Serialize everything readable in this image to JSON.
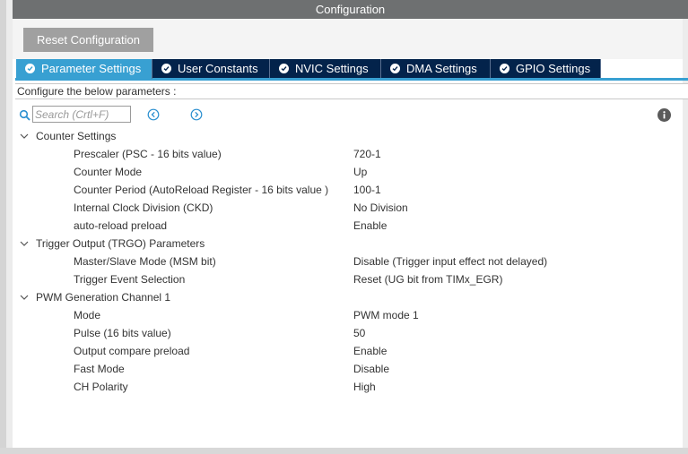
{
  "window": {
    "title": "Configuration"
  },
  "toolbar": {
    "reset_label": "Reset Configuration"
  },
  "tabs": [
    {
      "label": "Parameter Settings",
      "active": true
    },
    {
      "label": "User Constants",
      "active": false
    },
    {
      "label": "NVIC Settings",
      "active": false
    },
    {
      "label": "DMA Settings",
      "active": false
    },
    {
      "label": "GPIO Settings",
      "active": false
    }
  ],
  "description": "Configure the below parameters :",
  "search": {
    "placeholder": "Search (Crtl+F)",
    "value": ""
  },
  "icons": {
    "search": "search-icon",
    "previous": "chevron-left-circle-icon",
    "next": "chevron-right-circle-icon",
    "info": "info-icon",
    "tab_check": "check-circle-icon",
    "group_toggle": "chevron-down-icon"
  },
  "colors": {
    "title_bar": "#6e7071",
    "tab_active": "#38a0d2",
    "tab_inactive": "#03234b",
    "reset_button": "#a0a0a0",
    "accent_icons": "#2a8fd0"
  },
  "groups": [
    {
      "label": "Counter Settings",
      "params": [
        {
          "label": "Prescaler (PSC - 16 bits value)",
          "value": "720-1"
        },
        {
          "label": "Counter Mode",
          "value": "Up"
        },
        {
          "label": "Counter Period (AutoReload Register - 16 bits value )",
          "value": "100-1"
        },
        {
          "label": "Internal Clock Division (CKD)",
          "value": "No Division"
        },
        {
          "label": "auto-reload preload",
          "value": "Enable"
        }
      ]
    },
    {
      "label": "Trigger Output (TRGO) Parameters",
      "params": [
        {
          "label": "Master/Slave Mode (MSM bit)",
          "value": "Disable (Trigger input effect not delayed)"
        },
        {
          "label": "Trigger Event Selection",
          "value": "Reset (UG bit from TIMx_EGR)"
        }
      ]
    },
    {
      "label": "PWM Generation Channel 1",
      "params": [
        {
          "label": "Mode",
          "value": "PWM mode 1"
        },
        {
          "label": "Pulse (16 bits value)",
          "value": "50"
        },
        {
          "label": "Output compare preload",
          "value": "Enable"
        },
        {
          "label": "Fast Mode",
          "value": "Disable"
        },
        {
          "label": "CH Polarity",
          "value": "High"
        }
      ]
    }
  ]
}
